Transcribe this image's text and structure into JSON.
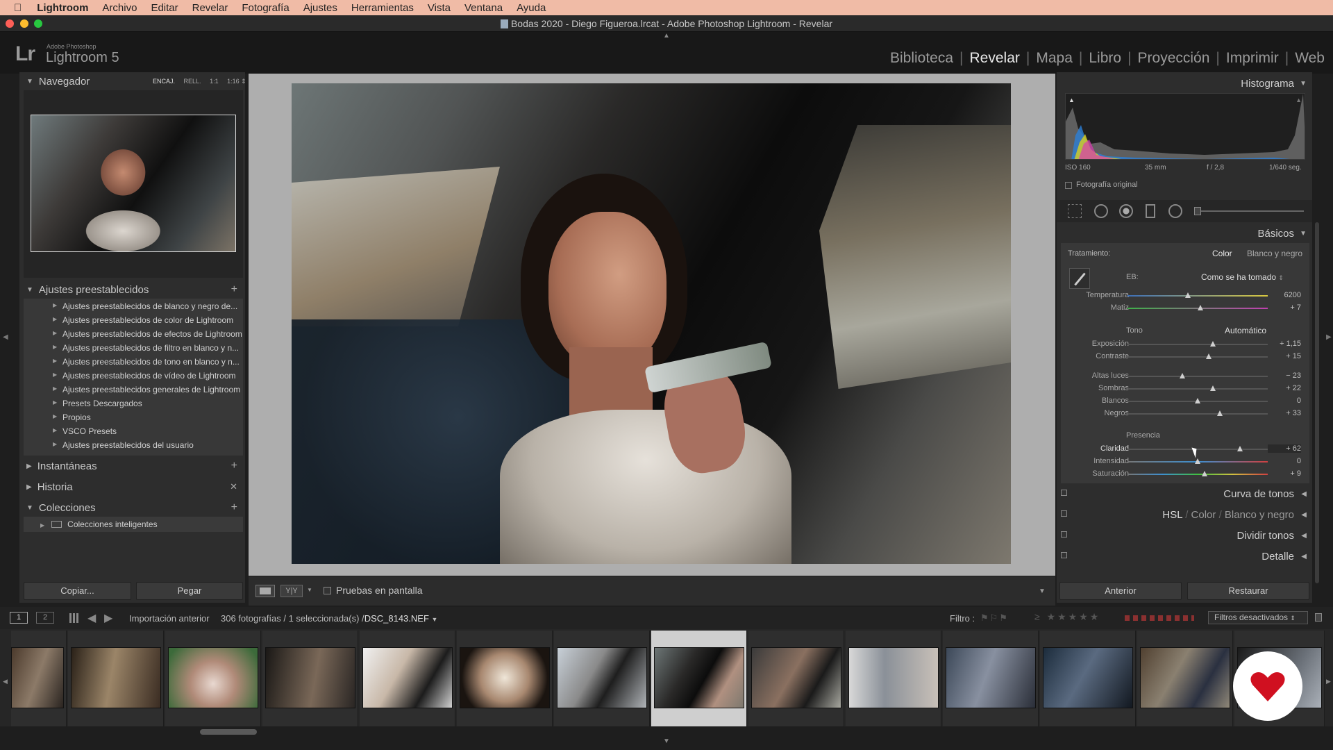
{
  "menubar": {
    "app": "Lightroom",
    "items": [
      "Archivo",
      "Editar",
      "Revelar",
      "Fotografía",
      "Ajustes",
      "Herramientas",
      "Vista",
      "Ventana",
      "Ayuda"
    ]
  },
  "window": {
    "title": "Bodas 2020 - Diego Figueroa.lrcat - Adobe Photoshop Lightroom - Revelar"
  },
  "identity": {
    "logo": "Lr",
    "brand_small": "Adobe Photoshop",
    "brand": "Lightroom 5"
  },
  "modules": [
    "Biblioteca",
    "Revelar",
    "Mapa",
    "Libro",
    "Proyección",
    "Imprimir",
    "Web"
  ],
  "left": {
    "navigator": {
      "title": "Navegador",
      "zoom": [
        "ENCAJ.",
        "RELL.",
        "1:1",
        "1:16"
      ]
    },
    "presets": {
      "title": "Ajustes preestablecidos",
      "items": [
        "Ajustes preestablecidos de blanco y negro de...",
        "Ajustes preestablecidos de color de Lightroom",
        "Ajustes preestablecidos de efectos de Lightroom",
        "Ajustes preestablecidos de filtro en blanco y n...",
        "Ajustes preestablecidos de tono en blanco y n...",
        "Ajustes preestablecidos de vídeo de Lightroom",
        "Ajustes preestablecidos generales de Lightroom",
        "Presets Descargados",
        "Propios",
        "VSCO Presets",
        "Ajustes preestablecidos del usuario"
      ]
    },
    "snapshots": "Instantáneas",
    "history": "Historia",
    "collections": {
      "title": "Colecciones",
      "item": "Colecciones inteligentes"
    },
    "copy_label": "Copiar...",
    "paste_label": "Pegar"
  },
  "toolbar": {
    "soft_proof": "Pruebas en pantalla",
    "view_yy": "Y|Y"
  },
  "right": {
    "histogram": {
      "title": "Histograma",
      "iso": "ISO 160",
      "focal": "35 mm",
      "aperture": "f / 2,8",
      "shutter": "1/640 seg.",
      "original": "Fotografía original"
    },
    "basic": {
      "title": "Básicos",
      "treatment_label": "Tratamiento:",
      "color": "Color",
      "bw": "Blanco y negro",
      "wb_label": "EB:",
      "wb_value": "Como se ha tomado",
      "tone_label": "Tono",
      "auto": "Automático",
      "presence_label": "Presencia"
    },
    "sliders": [
      {
        "label": "Temperatura",
        "value": "6200",
        "pos": 0.43
      },
      {
        "label": "Matiz",
        "value": "+ 7",
        "pos": 0.52
      },
      {
        "label": "Exposición",
        "value": "+ 1,15",
        "pos": 0.61
      },
      {
        "label": "Contraste",
        "value": "+ 15",
        "pos": 0.58
      },
      {
        "label": "Altas luces",
        "value": "− 23",
        "pos": 0.39
      },
      {
        "label": "Sombras",
        "value": "+ 22",
        "pos": 0.61
      },
      {
        "label": "Blancos",
        "value": "0",
        "pos": 0.5
      },
      {
        "label": "Negros",
        "value": "+ 33",
        "pos": 0.66
      },
      {
        "label": "Claridad",
        "value": "+ 62",
        "pos": 0.8
      },
      {
        "label": "Intensidad",
        "value": "0",
        "pos": 0.5
      },
      {
        "label": "Saturación",
        "value": "+ 9",
        "pos": 0.55
      }
    ],
    "tone_curve": "Curva de tonos",
    "hsl": {
      "a": "HSL",
      "b": "Color",
      "c": "Blanco y negro"
    },
    "split": "Dividir tonos",
    "detail": "Detalle",
    "prev_label": "Anterior",
    "reset_label": "Restaurar"
  },
  "filmstrip": {
    "source": "Importación anterior",
    "count": "306 fotografías / 1 seleccionada(s) /",
    "file": "DSC_8143.NEF",
    "filter_label": "Filtro :",
    "filter_state": "Filtros desactivados",
    "page1": "1",
    "page2": "2"
  }
}
